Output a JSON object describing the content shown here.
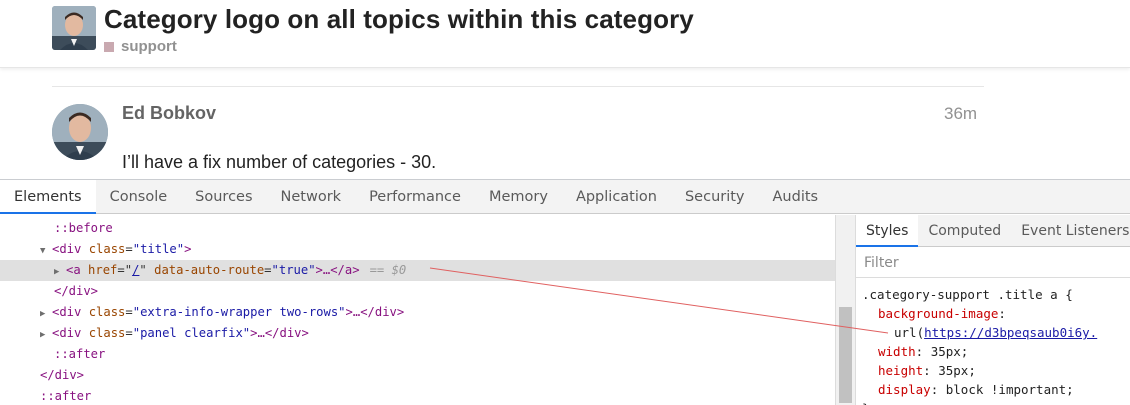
{
  "topic": {
    "title": "Category logo on all topics within this category",
    "category": "support",
    "category_color": "#c9a9b0"
  },
  "post": {
    "author": "Ed Bobkov",
    "time": "36m",
    "body": "I’ll have a fix number of categories - 30."
  },
  "devtools": {
    "tabs": [
      "Elements",
      "Console",
      "Sources",
      "Network",
      "Performance",
      "Memory",
      "Application",
      "Security",
      "Audits"
    ],
    "active_tab": "Elements",
    "dom": {
      "before": "::before",
      "div_open": "<div",
      "class_attr": "class",
      "title_val": "\"title\"",
      "a_open": "<a",
      "href_attr": "href",
      "href_val": "/",
      "data_auto_attr": "data-auto-route",
      "data_auto_val": "\"true\"",
      "ellipsis_close_a": ">…</a>",
      "selected_ref": "== $0",
      "div_close": "</div>",
      "extra_info_val": "\"extra-info-wrapper two-rows\"",
      "panel_val": "\"panel clearfix\"",
      "ellipsis_close_div": ">…</div>",
      "after": "::after"
    },
    "styles": {
      "tabs": [
        "Styles",
        "Computed",
        "Event Listeners"
      ],
      "active_tab": "Styles",
      "filter_placeholder": "Filter",
      "selector": ".category-support .title a {",
      "rules": [
        {
          "prop": "background-image",
          "value": ""
        },
        {
          "prop": "",
          "value": "url(",
          "url": "https://d3bpeqsaub0i6y."
        },
        {
          "prop": "width",
          "value": "35px;"
        },
        {
          "prop": "height",
          "value": "35px;"
        },
        {
          "prop": "display",
          "value": "block !important;"
        }
      ],
      "close": "}"
    },
    "accent_color": "#1a73e8",
    "annotation_color": "#e06060"
  }
}
